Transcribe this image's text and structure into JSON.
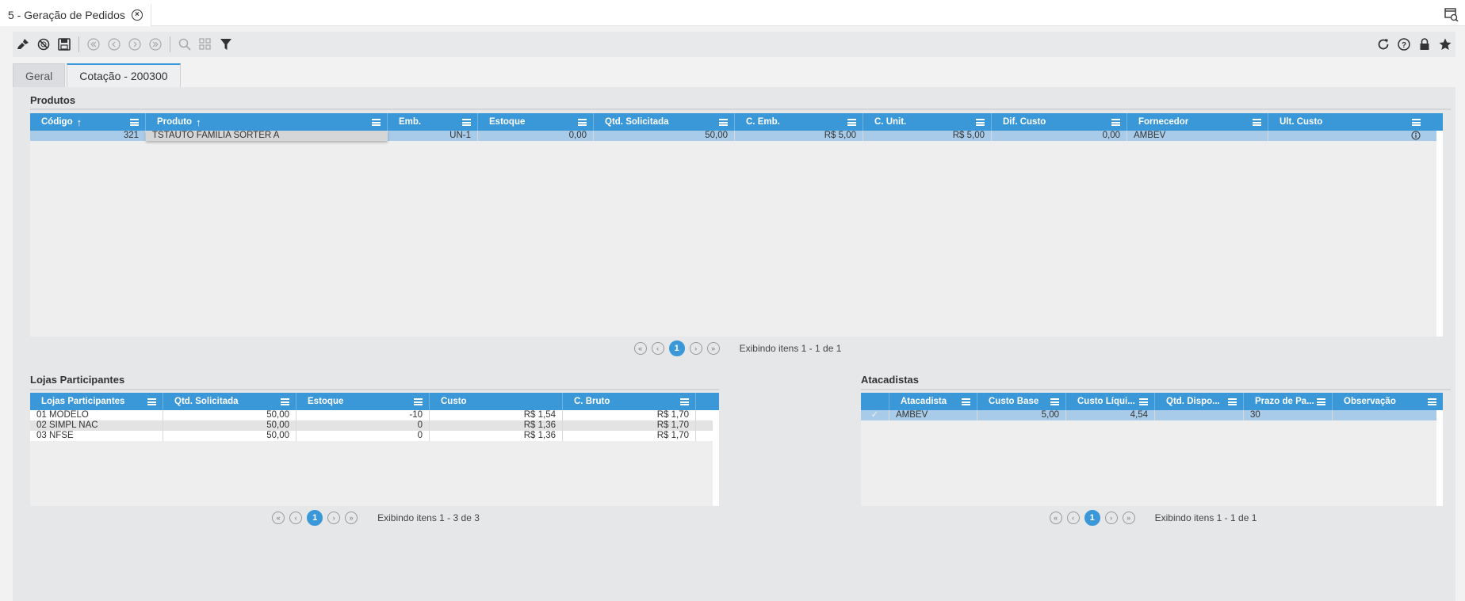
{
  "document_tab": {
    "title": "5 - Geração de Pedidos"
  },
  "view_tabs": [
    {
      "label": "Geral"
    },
    {
      "label": "Cotação - 200300"
    }
  ],
  "produtos": {
    "title": "Produtos",
    "columns": [
      "Código",
      "Produto",
      "Emb.",
      "Estoque",
      "Qtd. Solicitada",
      "C. Emb.",
      "C. Unit.",
      "Dif. Custo",
      "Fornecedor",
      "Ult. Custo"
    ],
    "rows": [
      {
        "codigo": "321",
        "produto": "TSTAUTO FAMILIA SORTER A",
        "emb": "UN-1",
        "estoque": "0,00",
        "qtd": "50,00",
        "c_emb": "R$ 5,00",
        "c_unit": "R$ 5,00",
        "dif": "0,00",
        "fornecedor": "AMBEV",
        "ult": ""
      }
    ],
    "pager": {
      "page": "1",
      "text": "Exibindo itens 1 - 1 de 1"
    }
  },
  "lojas": {
    "title": "Lojas Participantes",
    "columns": [
      "Lojas Participantes",
      "Qtd. Solicitada",
      "Estoque",
      "Custo",
      "C. Bruto"
    ],
    "rows": [
      {
        "loja": "01 MODELO",
        "qtd": "50,00",
        "estoque": "-10",
        "custo": "R$ 1,54",
        "bruto": "R$ 1,70"
      },
      {
        "loja": "02 SIMPL NAC",
        "qtd": "50,00",
        "estoque": "0",
        "custo": "R$ 1,36",
        "bruto": "R$ 1,70"
      },
      {
        "loja": "03 NFSE",
        "qtd": "50,00",
        "estoque": "0",
        "custo": "R$ 1,36",
        "bruto": "R$ 1,70"
      }
    ],
    "pager": {
      "page": "1",
      "text": "Exibindo itens 1 - 3 de 3"
    }
  },
  "atacadistas": {
    "title": "Atacadistas",
    "columns": [
      "Atacadista",
      "Custo Base",
      "Custo Líqui...",
      "Qtd. Dispo...",
      "Prazo de Pa...",
      "Observação"
    ],
    "rows": [
      {
        "atacadista": "AMBEV",
        "base": "5,00",
        "liquido": "4,54",
        "qtd": "",
        "prazo": "30",
        "obs": ""
      }
    ],
    "pager": {
      "page": "1",
      "text": "Exibindo itens 1 - 1 de 1"
    }
  },
  "colors": {
    "accent": "#3a97d8",
    "selected_row": "#a7cbe9"
  }
}
